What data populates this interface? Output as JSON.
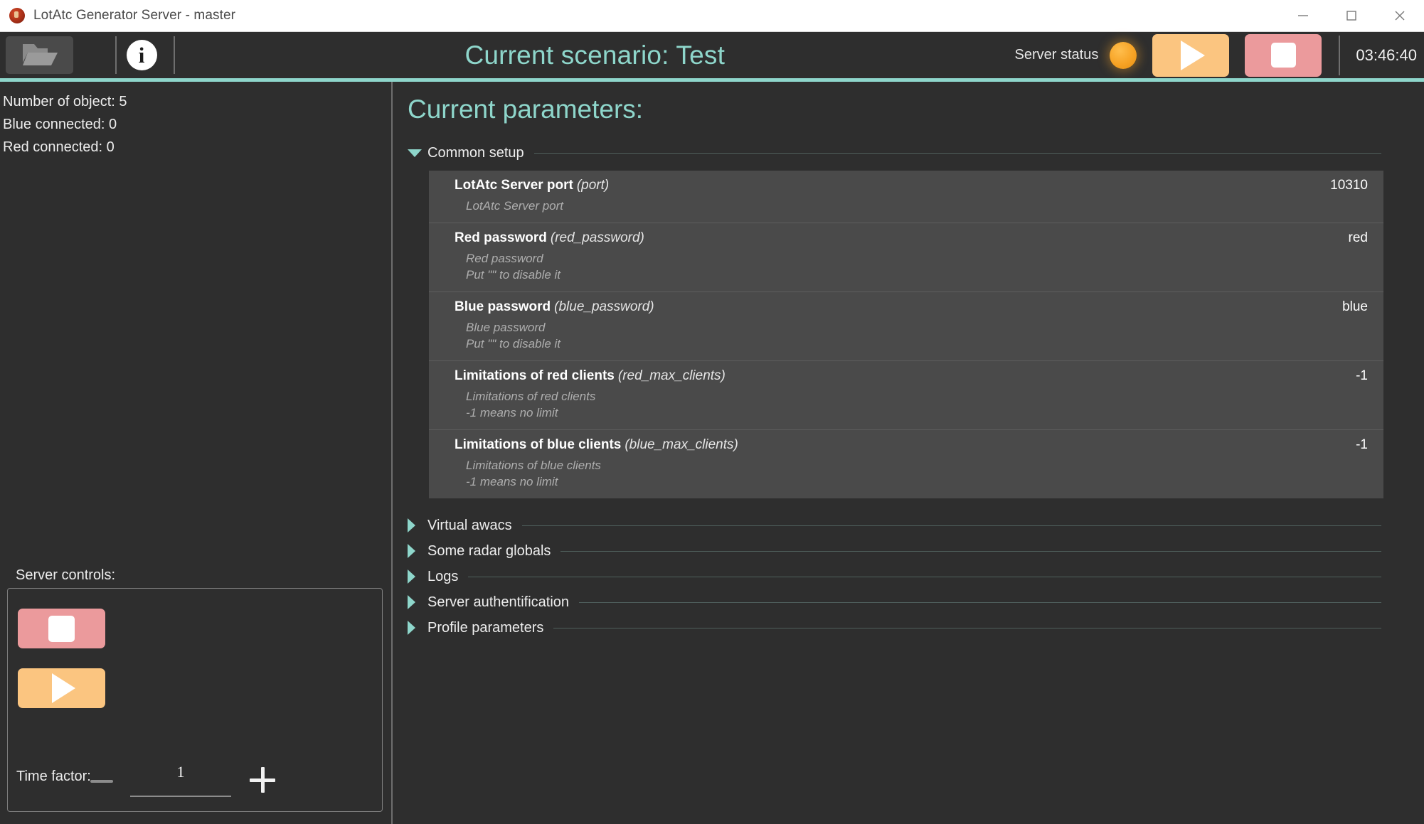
{
  "window": {
    "title": "LotAtc Generator Server - master",
    "app_icon": "lotatc-logo-icon",
    "controls": {
      "minimize": "minimize-icon",
      "maximize": "maximize-icon",
      "close": "close-icon"
    }
  },
  "toolbar": {
    "open_icon": "folder-open-icon",
    "info_icon": "info-icon",
    "scenario_title": "Current scenario: Test",
    "status_label": "Server status",
    "status_led_color": "#f7a325",
    "start_icon": "play-icon",
    "stop_icon": "stop-icon",
    "start_color": "#fbc580",
    "stop_color": "#eb9a9c",
    "clock": "03:46:40",
    "accent_color": "#8ed6cb"
  },
  "sidebar": {
    "stats": [
      "Number of object: 5",
      "Blue connected: 0",
      "Red connected: 0"
    ],
    "controls_label": "Server controls:",
    "stop_icon": "stop-icon",
    "start_icon": "play-icon",
    "time_factor_label": "Time factor:",
    "time_factor_value": "1",
    "decrement_label": "minus-icon",
    "increment_label": "plus-icon"
  },
  "main": {
    "heading": "Current parameters:",
    "groups": [
      {
        "label": "Common setup",
        "expanded": true
      },
      {
        "label": "Virtual awacs",
        "expanded": false
      },
      {
        "label": "Some radar globals",
        "expanded": false
      },
      {
        "label": "Logs",
        "expanded": false
      },
      {
        "label": "Server authentification",
        "expanded": false
      },
      {
        "label": "Profile parameters",
        "expanded": false
      }
    ],
    "parameters": [
      {
        "title": "LotAtc Server port",
        "key": "(port)",
        "desc": "LotAtc Server port",
        "value": "10310"
      },
      {
        "title": "Red password",
        "key": "(red_password)",
        "desc": "Red password\nPut \"\" to disable it",
        "value": "red"
      },
      {
        "title": "Blue password",
        "key": "(blue_password)",
        "desc": "Blue password\nPut \"\" to disable it",
        "value": "blue"
      },
      {
        "title": "Limitations of red clients",
        "key": "(red_max_clients)",
        "desc": "Limitations of red clients\n-1 means no limit",
        "value": "-1"
      },
      {
        "title": "Limitations of blue clients",
        "key": "(blue_max_clients)",
        "desc": "Limitations of blue clients\n-1 means no limit",
        "value": "-1"
      }
    ]
  }
}
